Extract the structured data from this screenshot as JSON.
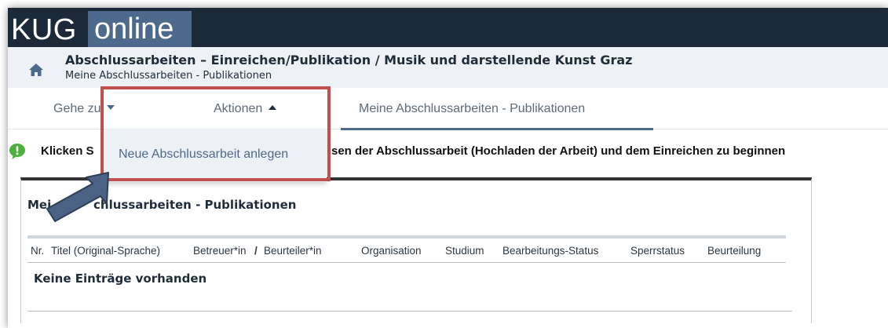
{
  "brand": {
    "part1": "KUG",
    "part2": "online"
  },
  "breadcrumb": {
    "title": "Abschlussarbeiten – Einreichen/Publikation  / Musik und darstellende Kunst Graz",
    "subtitle": "Meine Abschlussarbeiten - Publikationen",
    "home_icon": "home-icon"
  },
  "tabs": {
    "goto_label": "Gehe zu",
    "actions_label": "Aktionen",
    "active_label": "Meine Abschlussarbeiten - Publikationen"
  },
  "dropdown": {
    "item_label": "Neue Abschlussarbeit anlegen"
  },
  "info": {
    "icon": "info-bubble-icon",
    "text_visible_left": "Klicken S",
    "text_visible_right": "sen der Abschlussarbeit (Hochladen der Arbeit) und dem Einreichen zu beginnen"
  },
  "panel": {
    "title_left": "Mei",
    "title_right": "chlussarbeiten - Publikationen",
    "columns": [
      "Nr.",
      "Titel (Original-Sprache)",
      "Betreuer*in",
      "/",
      "Beurteiler*in",
      "Organisation",
      "Studium",
      "Bearbeitungs-Status",
      "Sperrstatus",
      "Beurteilung"
    ],
    "empty_text": "Keine Einträge vorhanden"
  },
  "colors": {
    "topbar": "#1c2939",
    "brand_accent": "#4d6a8d",
    "highlight_border": "#c0504d",
    "arrow_fill": "#4b6285",
    "info_green": "#4caf3e"
  }
}
